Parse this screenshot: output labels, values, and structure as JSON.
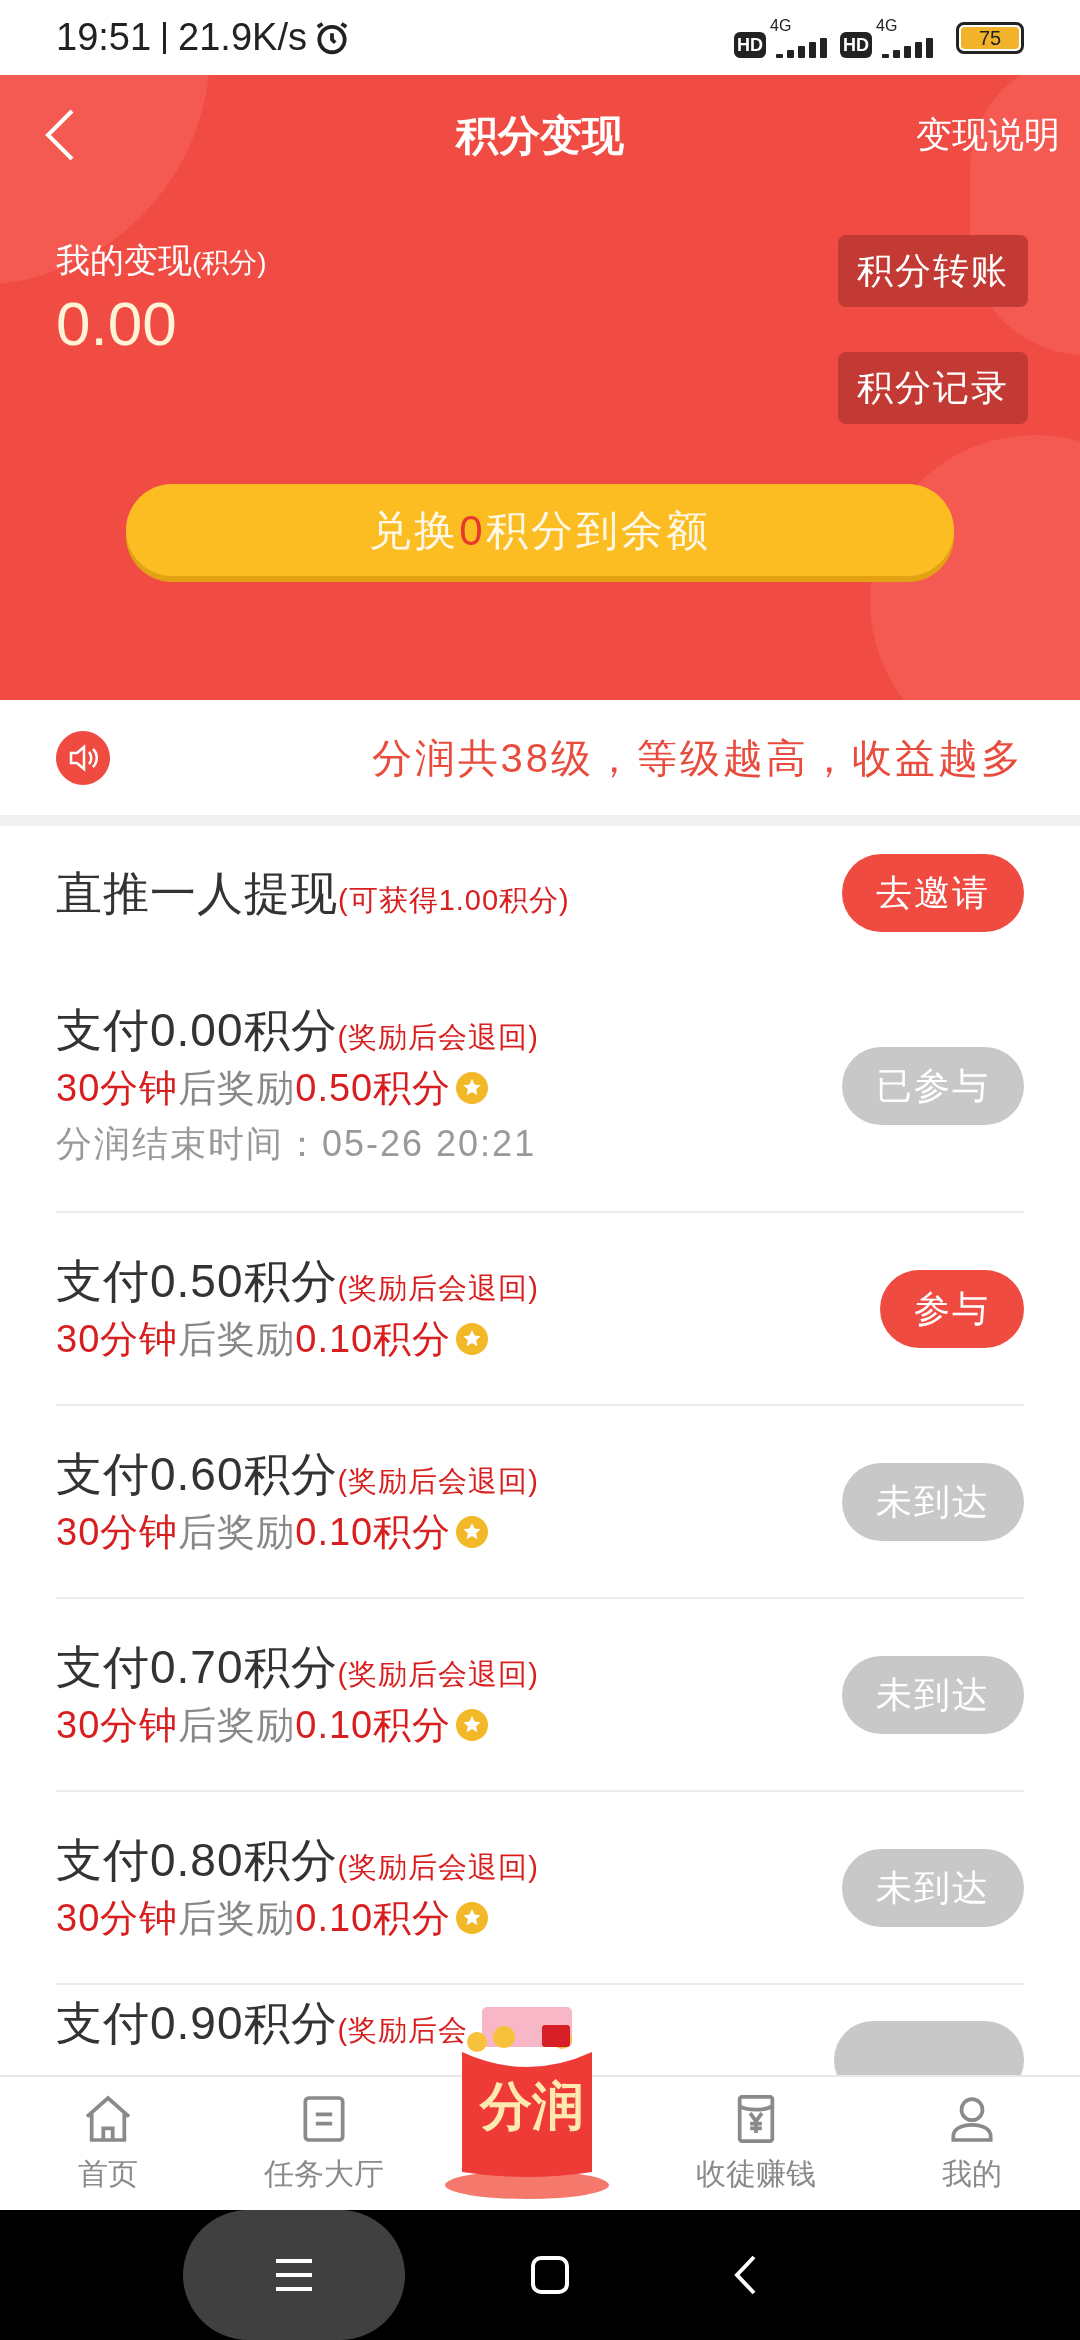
{
  "status_bar": {
    "time": "19:51",
    "speed": "21.9K/s",
    "sims": [
      {
        "hd": "HD",
        "net": "4G"
      },
      {
        "hd": "HD",
        "net": "4G"
      }
    ],
    "battery": "75"
  },
  "header": {
    "title": "积分变现",
    "help_link": "变现说明",
    "balance_label": "我的变现",
    "balance_unit": "(积分)",
    "balance": "0.00",
    "actions": [
      "积分转账",
      "积分记录"
    ],
    "exchange_button": {
      "prefix": "兑换",
      "amount": "0",
      "suffix": "积分到余额"
    }
  },
  "notice": "分润共38级，等级越高，收益越多",
  "rows": [
    {
      "kind": "invite",
      "title": "直推一人提现",
      "note": "(可获得1.00积分)",
      "button": {
        "label": "去邀请",
        "disabled": false
      }
    },
    {
      "kind": "task",
      "title": "支付0.00积分",
      "note": "(奖励后会退回)",
      "delay": "30分钟",
      "mid": "后奖励",
      "reward": "0.50积分",
      "end_time": "分润结束时间：05-26 20:21",
      "button": {
        "label": "已参与",
        "disabled": true
      }
    },
    {
      "kind": "task",
      "title": "支付0.50积分",
      "note": "(奖励后会退回)",
      "delay": "30分钟",
      "mid": "后奖励",
      "reward": "0.10积分",
      "button": {
        "label": "参与",
        "disabled": false
      }
    },
    {
      "kind": "task",
      "title": "支付0.60积分",
      "note": "(奖励后会退回)",
      "delay": "30分钟",
      "mid": "后奖励",
      "reward": "0.10积分",
      "button": {
        "label": "未到达",
        "disabled": true
      }
    },
    {
      "kind": "task",
      "title": "支付0.70积分",
      "note": "(奖励后会退回)",
      "delay": "30分钟",
      "mid": "后奖励",
      "reward": "0.10积分",
      "button": {
        "label": "未到达",
        "disabled": true
      }
    },
    {
      "kind": "task",
      "title": "支付0.80积分",
      "note": "(奖励后会退回)",
      "delay": "30分钟",
      "mid": "后奖励",
      "reward": "0.10积分",
      "button": {
        "label": "未到达",
        "disabled": true
      }
    },
    {
      "kind": "cut",
      "title": "支付0.90积分",
      "note": "(奖励后会",
      "button": {
        "disabled": true
      }
    }
  ],
  "tab_bar": [
    {
      "label": "首页",
      "kind": "home"
    },
    {
      "label": "任务大厅",
      "kind": "tasks"
    },
    {
      "label": "分润",
      "kind": "feature"
    },
    {
      "label": "收徒赚钱",
      "kind": "earn"
    },
    {
      "label": "我的",
      "kind": "profile"
    }
  ]
}
